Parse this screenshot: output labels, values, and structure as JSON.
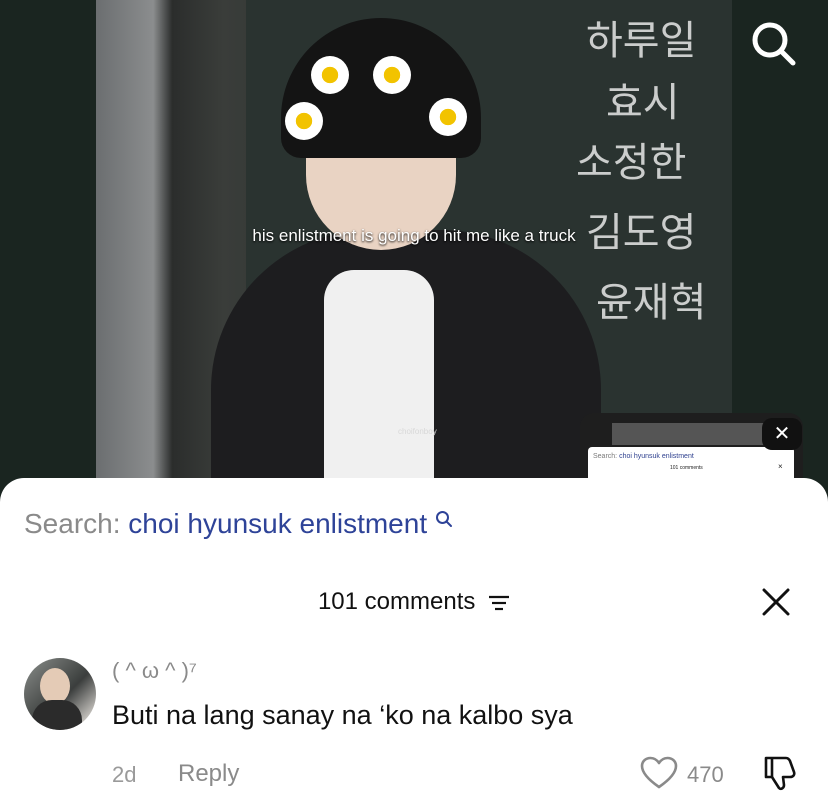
{
  "video": {
    "caption": "his enlistment is going to hit me like a truck",
    "watermark": "choifonboy"
  },
  "top_bar": {
    "search_icon": "search-icon"
  },
  "mini_player": {
    "search_prefix": "Search:",
    "search_query": "choi hyunsuk enlistment",
    "comment_count": "101 comments",
    "close_icon": "close-icon"
  },
  "comments_sheet": {
    "search_prefix": "Search:",
    "search_query": "choi hyunsuk enlistment",
    "comment_count_label": "101 comments",
    "filter_icon": "filter-icon",
    "close_icon": "close-icon"
  },
  "comments": [
    {
      "username": "( ^ ω ^ )⁷",
      "text": "Buti na lang sanay na ‘ko na kalbo sya",
      "age": "2d",
      "reply_label": "Reply",
      "likes": "470"
    }
  ],
  "colors": {
    "accent_blue": "#2e4398",
    "muted_gray": "#8a8a8a",
    "background_dark": "#17221d"
  }
}
